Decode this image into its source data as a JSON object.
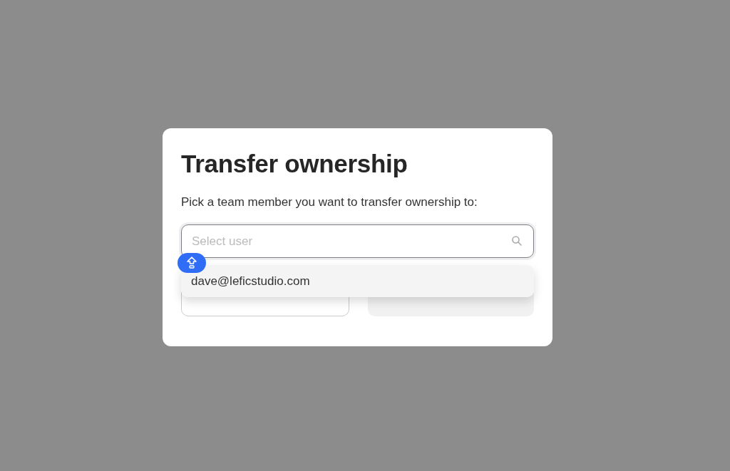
{
  "dialog": {
    "title": "Transfer ownership",
    "message": "Pick a team member you want to transfer ownership to:",
    "user_field": {
      "placeholder": "Select user",
      "expanded": true
    },
    "options": [
      {
        "label": "dave@leficstudio.com",
        "selected": false
      }
    ],
    "buttons": [
      {
        "kind": "secondary",
        "disabled": false
      },
      {
        "kind": "primary",
        "disabled": true
      }
    ]
  }
}
